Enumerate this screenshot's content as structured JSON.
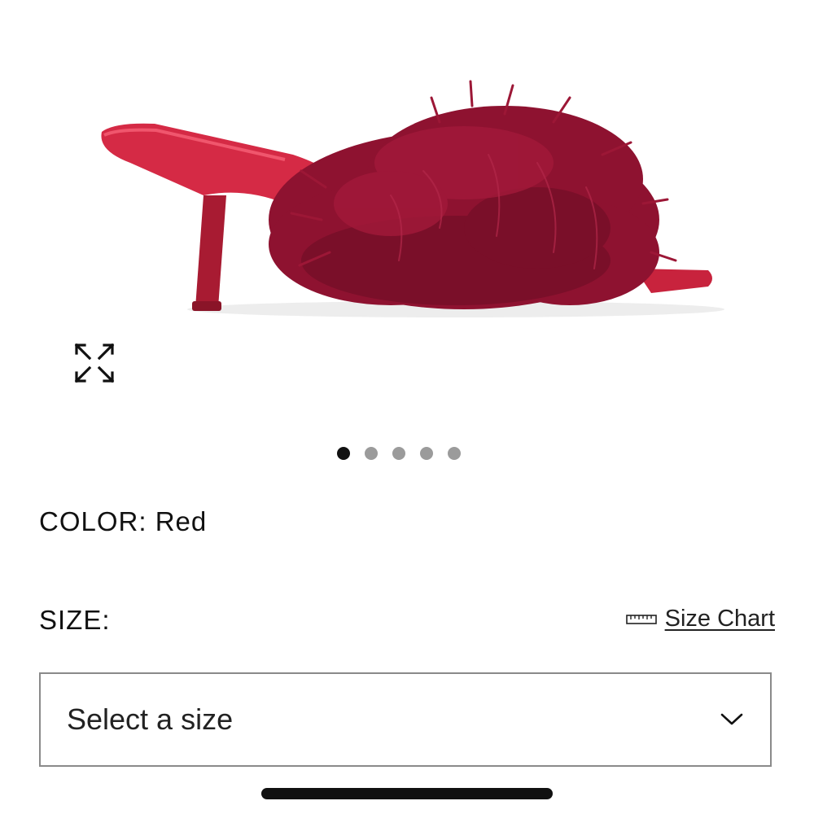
{
  "product": {
    "image_alt": "Red feather kitten-heel mule sandal",
    "color_label": "COLOR:",
    "color_value": "Red",
    "colors": {
      "shoe_main": "#8e1230",
      "shoe_shadow": "#6d0c22",
      "strap": "#c7213a"
    }
  },
  "carousel": {
    "count": 5,
    "active_index": 0
  },
  "size": {
    "label": "SIZE:",
    "chart_link": "Size Chart",
    "select_placeholder": "Select a size"
  },
  "icons": {
    "expand": "expand-arrows-icon",
    "ruler": "ruler-icon",
    "chevron": "chevron-down-icon"
  }
}
